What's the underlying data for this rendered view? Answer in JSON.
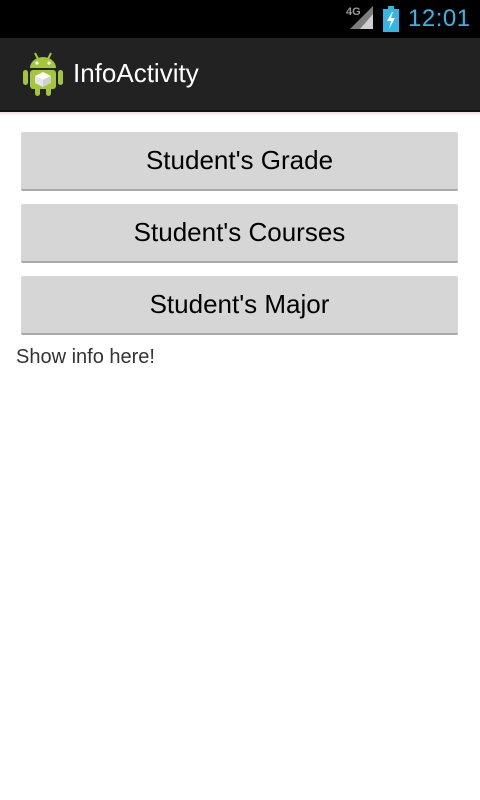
{
  "status_bar": {
    "network_label": "4G",
    "time": "12:01",
    "colors": {
      "background": "#000000",
      "time": "#33b5e5",
      "battery": "#33b5e5"
    },
    "icons": [
      "signal-icon",
      "battery-charging-icon"
    ]
  },
  "action_bar": {
    "title": "InfoActivity",
    "icon": "android-app-icon",
    "colors": {
      "background": "#222222",
      "title": "#ffffff"
    }
  },
  "buttons": {
    "grade": "Student's Grade",
    "courses": "Student's Courses",
    "major": "Student's Major"
  },
  "info_text": "Show info here!"
}
